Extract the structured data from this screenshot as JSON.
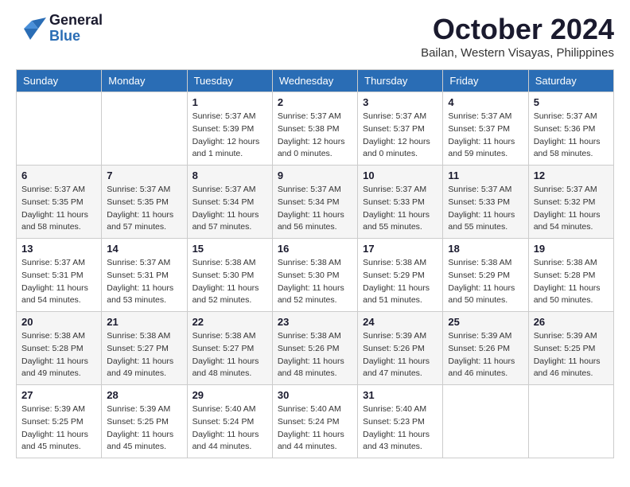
{
  "logo": {
    "line1": "General",
    "line2": "Blue"
  },
  "title": "October 2024",
  "location": "Bailan, Western Visayas, Philippines",
  "days_header": [
    "Sunday",
    "Monday",
    "Tuesday",
    "Wednesday",
    "Thursday",
    "Friday",
    "Saturday"
  ],
  "weeks": [
    [
      {
        "day": "",
        "detail": ""
      },
      {
        "day": "",
        "detail": ""
      },
      {
        "day": "1",
        "detail": "Sunrise: 5:37 AM\nSunset: 5:39 PM\nDaylight: 12 hours\nand 1 minute."
      },
      {
        "day": "2",
        "detail": "Sunrise: 5:37 AM\nSunset: 5:38 PM\nDaylight: 12 hours\nand 0 minutes."
      },
      {
        "day": "3",
        "detail": "Sunrise: 5:37 AM\nSunset: 5:37 PM\nDaylight: 12 hours\nand 0 minutes."
      },
      {
        "day": "4",
        "detail": "Sunrise: 5:37 AM\nSunset: 5:37 PM\nDaylight: 11 hours\nand 59 minutes."
      },
      {
        "day": "5",
        "detail": "Sunrise: 5:37 AM\nSunset: 5:36 PM\nDaylight: 11 hours\nand 58 minutes."
      }
    ],
    [
      {
        "day": "6",
        "detail": "Sunrise: 5:37 AM\nSunset: 5:35 PM\nDaylight: 11 hours\nand 58 minutes."
      },
      {
        "day": "7",
        "detail": "Sunrise: 5:37 AM\nSunset: 5:35 PM\nDaylight: 11 hours\nand 57 minutes."
      },
      {
        "day": "8",
        "detail": "Sunrise: 5:37 AM\nSunset: 5:34 PM\nDaylight: 11 hours\nand 57 minutes."
      },
      {
        "day": "9",
        "detail": "Sunrise: 5:37 AM\nSunset: 5:34 PM\nDaylight: 11 hours\nand 56 minutes."
      },
      {
        "day": "10",
        "detail": "Sunrise: 5:37 AM\nSunset: 5:33 PM\nDaylight: 11 hours\nand 55 minutes."
      },
      {
        "day": "11",
        "detail": "Sunrise: 5:37 AM\nSunset: 5:33 PM\nDaylight: 11 hours\nand 55 minutes."
      },
      {
        "day": "12",
        "detail": "Sunrise: 5:37 AM\nSunset: 5:32 PM\nDaylight: 11 hours\nand 54 minutes."
      }
    ],
    [
      {
        "day": "13",
        "detail": "Sunrise: 5:37 AM\nSunset: 5:31 PM\nDaylight: 11 hours\nand 54 minutes."
      },
      {
        "day": "14",
        "detail": "Sunrise: 5:37 AM\nSunset: 5:31 PM\nDaylight: 11 hours\nand 53 minutes."
      },
      {
        "day": "15",
        "detail": "Sunrise: 5:38 AM\nSunset: 5:30 PM\nDaylight: 11 hours\nand 52 minutes."
      },
      {
        "day": "16",
        "detail": "Sunrise: 5:38 AM\nSunset: 5:30 PM\nDaylight: 11 hours\nand 52 minutes."
      },
      {
        "day": "17",
        "detail": "Sunrise: 5:38 AM\nSunset: 5:29 PM\nDaylight: 11 hours\nand 51 minutes."
      },
      {
        "day": "18",
        "detail": "Sunrise: 5:38 AM\nSunset: 5:29 PM\nDaylight: 11 hours\nand 50 minutes."
      },
      {
        "day": "19",
        "detail": "Sunrise: 5:38 AM\nSunset: 5:28 PM\nDaylight: 11 hours\nand 50 minutes."
      }
    ],
    [
      {
        "day": "20",
        "detail": "Sunrise: 5:38 AM\nSunset: 5:28 PM\nDaylight: 11 hours\nand 49 minutes."
      },
      {
        "day": "21",
        "detail": "Sunrise: 5:38 AM\nSunset: 5:27 PM\nDaylight: 11 hours\nand 49 minutes."
      },
      {
        "day": "22",
        "detail": "Sunrise: 5:38 AM\nSunset: 5:27 PM\nDaylight: 11 hours\nand 48 minutes."
      },
      {
        "day": "23",
        "detail": "Sunrise: 5:38 AM\nSunset: 5:26 PM\nDaylight: 11 hours\nand 48 minutes."
      },
      {
        "day": "24",
        "detail": "Sunrise: 5:39 AM\nSunset: 5:26 PM\nDaylight: 11 hours\nand 47 minutes."
      },
      {
        "day": "25",
        "detail": "Sunrise: 5:39 AM\nSunset: 5:26 PM\nDaylight: 11 hours\nand 46 minutes."
      },
      {
        "day": "26",
        "detail": "Sunrise: 5:39 AM\nSunset: 5:25 PM\nDaylight: 11 hours\nand 46 minutes."
      }
    ],
    [
      {
        "day": "27",
        "detail": "Sunrise: 5:39 AM\nSunset: 5:25 PM\nDaylight: 11 hours\nand 45 minutes."
      },
      {
        "day": "28",
        "detail": "Sunrise: 5:39 AM\nSunset: 5:25 PM\nDaylight: 11 hours\nand 45 minutes."
      },
      {
        "day": "29",
        "detail": "Sunrise: 5:40 AM\nSunset: 5:24 PM\nDaylight: 11 hours\nand 44 minutes."
      },
      {
        "day": "30",
        "detail": "Sunrise: 5:40 AM\nSunset: 5:24 PM\nDaylight: 11 hours\nand 44 minutes."
      },
      {
        "day": "31",
        "detail": "Sunrise: 5:40 AM\nSunset: 5:23 PM\nDaylight: 11 hours\nand 43 minutes."
      },
      {
        "day": "",
        "detail": ""
      },
      {
        "day": "",
        "detail": ""
      }
    ]
  ]
}
